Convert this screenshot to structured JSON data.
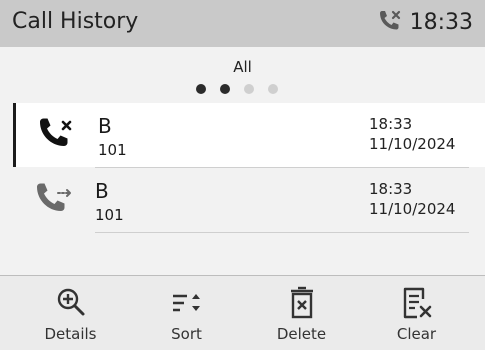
{
  "header": {
    "title": "Call History",
    "clock": "18:33",
    "status_icon": "missed-call-icon"
  },
  "filter": {
    "label": "All",
    "pages": 4,
    "active_pages": 2
  },
  "calls": [
    {
      "name": "B",
      "number": "101",
      "time": "18:33",
      "date": "11/10/2024",
      "type": "missed",
      "icon": "missed-call-icon",
      "selected": true
    },
    {
      "name": "B",
      "number": "101",
      "time": "18:33",
      "date": "11/10/2024",
      "type": "forwarded",
      "icon": "forwarded-call-icon",
      "selected": false
    }
  ],
  "softkeys": [
    {
      "label": "Details",
      "icon": "zoom-in-icon"
    },
    {
      "label": "Sort",
      "icon": "sort-icon"
    },
    {
      "label": "Delete",
      "icon": "trash-icon"
    },
    {
      "label": "Clear",
      "icon": "clear-list-icon"
    }
  ],
  "colors": {
    "titlebar": "#c9c9c9",
    "background": "#f2f2f2",
    "selected_row": "#ffffff",
    "dot_active": "#2b2b2b",
    "dot_inactive": "#cfcfcf"
  }
}
